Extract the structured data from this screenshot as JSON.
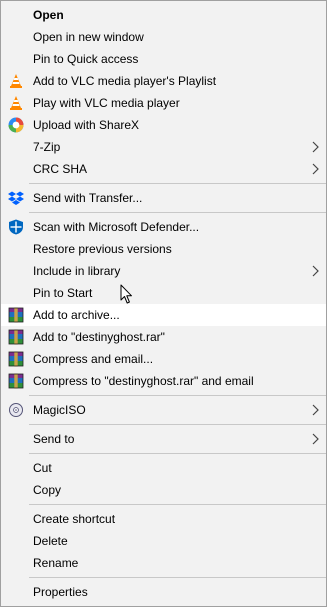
{
  "menu": {
    "items": [
      {
        "label": "Open"
      },
      {
        "label": "Open in new window"
      },
      {
        "label": "Pin to Quick access"
      },
      {
        "label": "Add to VLC media player's Playlist",
        "icon": "vlc-icon"
      },
      {
        "label": "Play with VLC media player",
        "icon": "vlc-icon"
      },
      {
        "label": "Upload with ShareX",
        "icon": "sharex-icon"
      },
      {
        "label": "7-Zip",
        "submenu": true
      },
      {
        "label": "CRC SHA",
        "submenu": true
      },
      {
        "label": "Send with Transfer...",
        "icon": "dropbox-icon"
      },
      {
        "label": "Scan with Microsoft Defender...",
        "icon": "defender-icon"
      },
      {
        "label": "Restore previous versions"
      },
      {
        "label": "Include in library",
        "submenu": true
      },
      {
        "label": "Pin to Start"
      },
      {
        "label": "Add to archive...",
        "icon": "winrar-icon"
      },
      {
        "label": "Add to \"destinyghost.rar\"",
        "icon": "winrar-icon"
      },
      {
        "label": "Compress and email...",
        "icon": "winrar-icon"
      },
      {
        "label": "Compress to \"destinyghost.rar\" and email",
        "icon": "winrar-icon"
      },
      {
        "label": "MagicISO",
        "icon": "magiciso-icon",
        "submenu": true
      },
      {
        "label": "Send to",
        "submenu": true
      },
      {
        "label": "Cut"
      },
      {
        "label": "Copy"
      },
      {
        "label": "Create shortcut"
      },
      {
        "label": "Delete"
      },
      {
        "label": "Rename"
      },
      {
        "label": "Properties"
      }
    ]
  },
  "colors": {
    "menu_background": "#f2f2f2",
    "hover_background": "#ffffff",
    "separator": "#c8c8c8",
    "vlc_orange": "#ff8800",
    "sharex_blue": "#2d8cf0",
    "dropbox_blue": "#0061fe",
    "defender_blue": "#0067c0"
  }
}
